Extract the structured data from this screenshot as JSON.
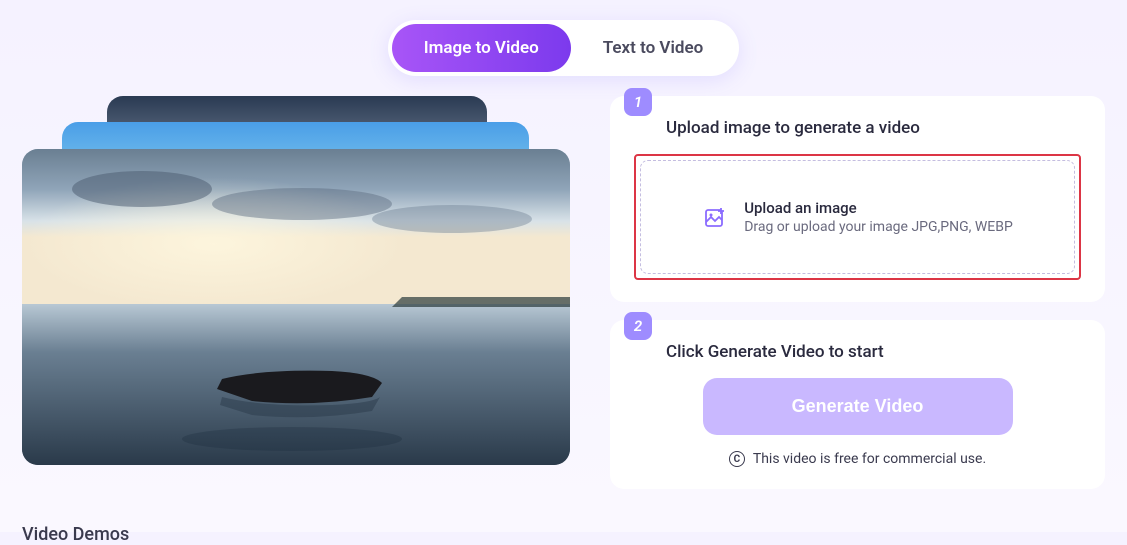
{
  "tabs": {
    "image_to_video": "Image to Video",
    "text_to_video": "Text to Video"
  },
  "step1": {
    "badge": "1",
    "title": "Upload image to generate a video",
    "upload_primary": "Upload an image",
    "upload_secondary": "Drag or upload your image JPG,PNG, WEBP"
  },
  "step2": {
    "badge": "2",
    "title": "Click Generate Video to start",
    "button_label": "Generate Video",
    "commercial_note": "This video is free for commercial use."
  },
  "video_demos_label": "Video Demos",
  "icons": {
    "upload_image": "image-plus-icon",
    "copyright": "C"
  }
}
